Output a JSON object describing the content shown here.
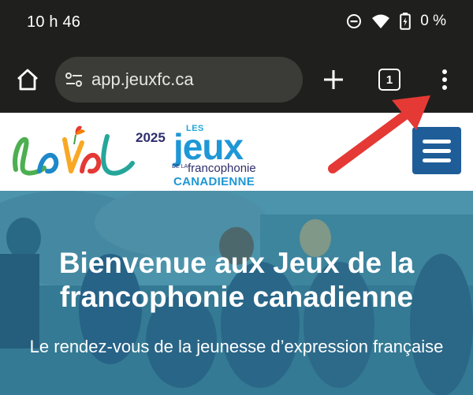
{
  "status_bar": {
    "time": "10 h 46",
    "battery_percent": "0 %",
    "icons": [
      "do-not-disturb-icon",
      "wifi-icon",
      "battery-charging-icon"
    ]
  },
  "browser": {
    "url": "app.jeuxfc.ca",
    "tab_count": "1",
    "icons": [
      "home-icon",
      "site-settings-icon",
      "new-tab-icon",
      "tab-switcher-icon",
      "more-menu-icon"
    ]
  },
  "site_header": {
    "logo": {
      "year": "2025",
      "les": "LES",
      "jeux": "jeux",
      "de_la": "DE LA",
      "francophonie": "francophonie",
      "canadienne": "CANADIENNE"
    },
    "menu_icon": "hamburger-icon"
  },
  "hero": {
    "title": "Bienvenue aux Jeux de la francophonie canadienne",
    "subtitle": "Le rendez-vous de la jeunesse d’expression française"
  },
  "colors": {
    "toolbar_bg": "#1f201d",
    "urlbar_bg": "#3b3c37",
    "menu_button_bg": "#1f5d99",
    "brand_blue": "#1f97d6",
    "arrow_red": "#e53935"
  }
}
